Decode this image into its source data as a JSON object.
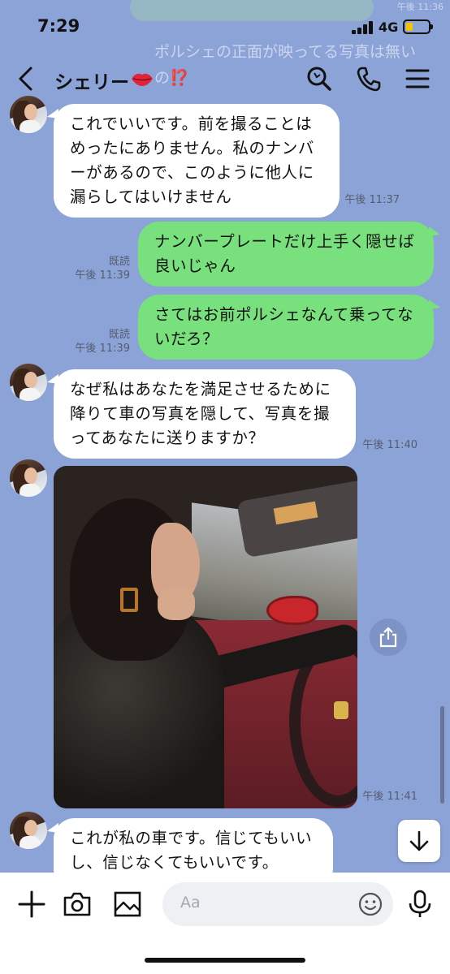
{
  "status": {
    "time": "7:29",
    "network": "4G",
    "battery_level": 0.3
  },
  "background": {
    "prev_text": "ポルシェの正面が映ってる写真は無いの",
    "prev_mark": "⁉️",
    "prev_time": "午後 11:36"
  },
  "header": {
    "back_icon": "chevron-left-icon",
    "title": "シェリー",
    "title_emoji": "lips-icon",
    "search_icon": "search-icon",
    "call_icon": "phone-icon",
    "menu_icon": "menu-icon"
  },
  "messages": [
    {
      "side": "in",
      "text": "これでいいです。前を撮ることはめったにありません。私のナンバーがあるので、このように他人に漏らしてはいけません",
      "time": "午後 11:37"
    },
    {
      "side": "out",
      "text": "ナンバープレートだけ上手く隠せば良いじゃん",
      "read": "既読",
      "time": "午後 11:39"
    },
    {
      "side": "out",
      "text": "さてはお前ポルシェなんて乗ってないだろ？",
      "read": "既読",
      "time": "午後 11:39"
    },
    {
      "side": "in",
      "text": "なぜ私はあなたを満足させるために降りて車の写真を隠して、写真を撮ってあなたに送りますか？",
      "time": "午後 11:40"
    },
    {
      "side": "in",
      "type": "photo",
      "time": "午後 11:41"
    },
    {
      "side": "in",
      "text": "これが私の車です。信じてもいいし、信じなくてもいいです。"
    }
  ],
  "composer": {
    "plus_icon": "plus-icon",
    "camera_icon": "camera-icon",
    "image_icon": "image-icon",
    "placeholder": "Aa",
    "emoji_icon": "smiley-icon",
    "mic_icon": "microphone-icon"
  },
  "colors": {
    "background": "#8ca3d8",
    "outgoing": "#78e07c",
    "incoming": "#ffffff"
  }
}
